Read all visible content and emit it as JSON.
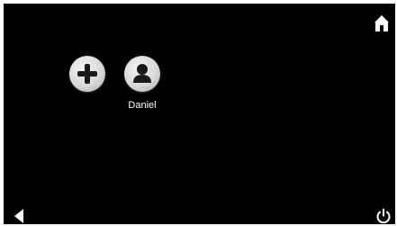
{
  "screen": {
    "background_color": "#000000",
    "icon_color": "#ffffff"
  },
  "header": {
    "home_icon": "home-icon"
  },
  "profiles": {
    "add_icon": "plus-icon",
    "items": [
      {
        "name": "Daniel",
        "icon": "person-icon"
      }
    ]
  },
  "footer": {
    "back_icon": "back-arrow-icon",
    "power_icon": "power-icon"
  }
}
